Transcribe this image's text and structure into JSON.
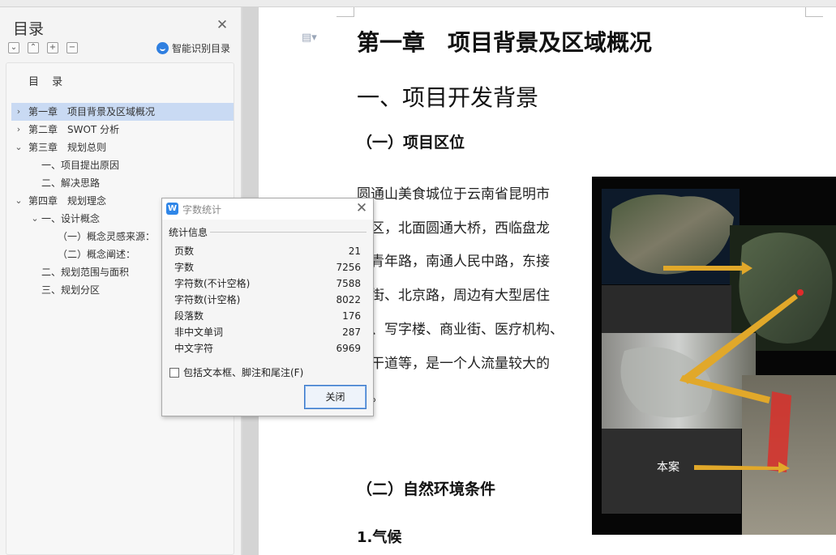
{
  "toc_panel": {
    "title": "目录",
    "smart_toc_label": "智能识别目录",
    "tools": [
      "⌄",
      "⌃",
      "+",
      "−"
    ],
    "heading": "目 录",
    "items": [
      {
        "label": "第一章　项目背景及区域概况",
        "level": 0,
        "chevron": "›",
        "active": true
      },
      {
        "label": "第二章　SWOT 分析",
        "level": 0,
        "chevron": "›",
        "active": false
      },
      {
        "label": "第三章　规划总则",
        "level": 0,
        "chevron": "⌄",
        "active": false
      },
      {
        "label": "一、项目提出原因",
        "level": 1,
        "chevron": "",
        "active": false
      },
      {
        "label": "二、解决思路",
        "level": 1,
        "chevron": "",
        "active": false
      },
      {
        "label": "第四章　规划理念",
        "level": 0,
        "chevron": "⌄",
        "active": false
      },
      {
        "label": "一、设计概念",
        "level": 1,
        "chevron": "⌄",
        "active": false
      },
      {
        "label": "（一）概念灵感来源：",
        "level": 2,
        "chevron": "",
        "active": false
      },
      {
        "label": "（二）概念阐述：",
        "level": 2,
        "chevron": "",
        "active": false
      },
      {
        "label": "二、规划范围与面积",
        "level": 1,
        "chevron": "",
        "active": false
      },
      {
        "label": "三、规划分区",
        "level": 1,
        "chevron": "",
        "active": false
      }
    ]
  },
  "document": {
    "chapter_title": "第一章　项目背景及区域概况",
    "section_title": "一、项目开发背景",
    "subsection_1": "（一）项目区位",
    "paragraph_lines": [
      "圆通山美食城位于云南省昆明市",
      "龙区，北面圆通大桥，西临盘龙",
      "、青年路，南通人民中路，东接",
      "源街、北京路，周边有大型居住",
      "区、写字楼、商业街、医疗机构、",
      "通干道等，是一个人流量较大的",
      "域。"
    ],
    "subsection_2": "（二）自然环境条件",
    "subheading_3": "1.气候",
    "map_label": "本案"
  },
  "dialog": {
    "title": "字数统计",
    "app_icon": "W",
    "section_label": "统计信息",
    "stats": [
      {
        "label": "页数",
        "value": "21"
      },
      {
        "label": "字数",
        "value": "7256"
      },
      {
        "label": "字符数(不计空格)",
        "value": "7588"
      },
      {
        "label": "字符数(计空格)",
        "value": "8022"
      },
      {
        "label": "段落数",
        "value": "176"
      },
      {
        "label": "非中文单词",
        "value": "287"
      },
      {
        "label": "中文字符",
        "value": "6969"
      }
    ],
    "checkbox_label": "包括文本框、脚注和尾注(F)",
    "checkbox_checked": false,
    "close_button": "关闭"
  },
  "colors": {
    "toc_active": "#c9daf3",
    "accent_blue": "#2f86e8",
    "arrow_gold": "#e1a82a",
    "site_red": "#d9302a"
  }
}
